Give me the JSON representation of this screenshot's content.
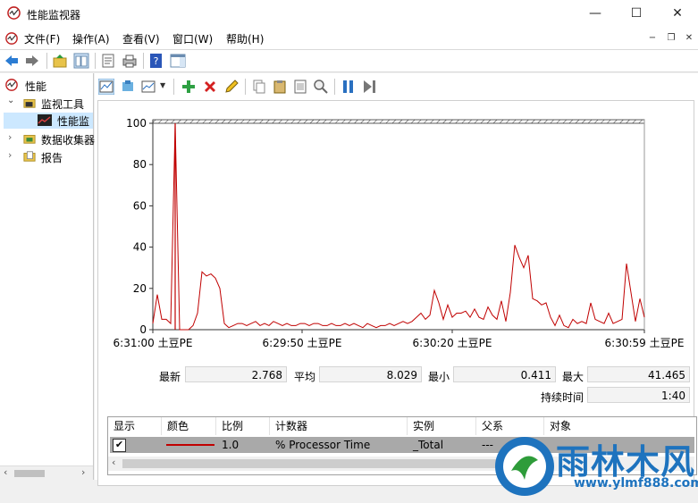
{
  "window": {
    "title": "性能监视器"
  },
  "menu": {
    "items": [
      "文件(F)",
      "操作(A)",
      "查看(V)",
      "窗口(W)",
      "帮助(H)"
    ]
  },
  "tree": {
    "items": [
      {
        "label": "性能",
        "level": 0,
        "expander": ""
      },
      {
        "label": "监视工具",
        "level": 1,
        "expander": "expanded"
      },
      {
        "label": "性能监",
        "level": 2,
        "expander": ""
      },
      {
        "label": "数据收集器",
        "level": 1,
        "expander": "collapsed"
      },
      {
        "label": "报告",
        "level": 1,
        "expander": "collapsed"
      }
    ]
  },
  "chart_data": {
    "type": "line",
    "ylim": [
      0,
      100
    ],
    "yticks": [
      "100",
      "80",
      "60",
      "40",
      "20",
      "0"
    ],
    "xticks": [
      "6:31:00 土豆PE",
      "6:29:50 土豆PE",
      "6:30:20 土豆PE",
      "6:30:59 土豆PE"
    ],
    "series": [
      {
        "name": "% Processor Time",
        "color": "#c00000",
        "values": [
          3,
          17,
          5,
          5,
          3,
          100,
          0,
          0,
          0,
          2,
          8,
          28,
          26,
          27,
          25,
          20,
          3,
          1,
          2,
          3,
          3,
          2,
          3,
          4,
          2,
          3,
          2,
          4,
          3,
          2,
          3,
          2,
          2,
          3,
          3,
          2,
          3,
          3,
          2,
          2,
          3,
          2,
          2,
          3,
          2,
          3,
          2,
          1,
          3,
          2,
          1,
          2,
          2,
          3,
          2,
          3,
          4,
          3,
          4,
          6,
          8,
          5,
          7,
          19,
          13,
          5,
          12,
          6,
          8,
          8,
          9,
          6,
          10,
          6,
          5,
          11,
          7,
          5,
          14,
          4,
          18,
          41,
          35,
          30,
          36,
          15,
          14,
          12,
          13,
          6,
          2,
          7,
          2,
          1,
          5,
          3,
          4,
          3,
          13,
          5,
          4,
          3,
          8,
          3,
          4,
          5,
          32,
          18,
          4,
          15,
          6
        ]
      }
    ],
    "cursor_x": 5
  },
  "stats": {
    "latest_label": "最新",
    "latest": "2.768",
    "avg_label": "平均",
    "avg": "8.029",
    "min_label": "最小",
    "min": "0.411",
    "max_label": "最大",
    "max": "41.465",
    "duration_label": "持续时间",
    "duration": "1:40"
  },
  "legend": {
    "headers": [
      "显示",
      "颜色",
      "比例",
      "计数器",
      "实例",
      "父系",
      "对象"
    ],
    "row": {
      "scale": "1.0",
      "counter": "% Processor Time",
      "instance": "_Total",
      "parent": "---"
    }
  },
  "watermark": {
    "brand": "雨林木风",
    "url": "www.ylmf888.com"
  },
  "colors": {
    "accent_blue": "#1e73be",
    "line_red": "#c00000"
  }
}
